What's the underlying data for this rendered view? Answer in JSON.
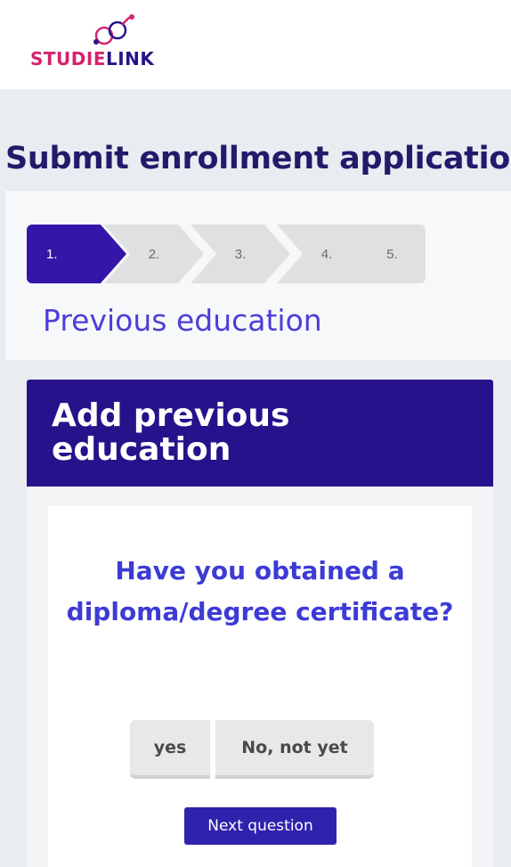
{
  "logo": {
    "part1": "STUDIE",
    "part2": "LINK",
    "colors": {
      "pink": "#d4246f",
      "navy": "#27148a"
    }
  },
  "page": {
    "title": "Submit enrollment application"
  },
  "steps": {
    "items": [
      "1.",
      "2.",
      "3.",
      "4.",
      "5."
    ],
    "active_index": 0,
    "current_label": "Previous education",
    "colors": {
      "active": "#3417a8",
      "inactive": "#dfe0e2"
    }
  },
  "card": {
    "title": "Add previous education",
    "question": "Have you obtained a diploma/degree certificate?",
    "choice_yes": "yes",
    "choice_no": "No, not yet",
    "next_label": "Next question",
    "colors": {
      "header": "#27128b",
      "question": "#3d3bd6",
      "button": "#2f22ad"
    }
  }
}
